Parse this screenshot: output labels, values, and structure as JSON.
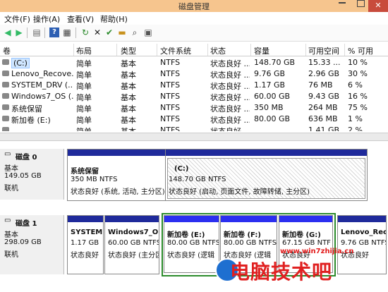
{
  "window": {
    "title": "磁盘管理"
  },
  "menu": [
    "文件(F)",
    "操作(A)",
    "查看(V)",
    "帮助(H)"
  ],
  "toolbar": [
    "back-icon",
    "forward-icon",
    "properties-icon",
    "help-icon",
    "view-icon",
    "refresh-icon",
    "delete-icon",
    "check-icon",
    "folder-open-icon",
    "search-icon",
    "settings-icon"
  ],
  "columns": [
    "卷",
    "布局",
    "类型",
    "文件系统",
    "状态",
    "容量",
    "可用空间",
    "% 可用"
  ],
  "volumes": [
    {
      "name": "(C:)",
      "layout": "简单",
      "type": "基本",
      "fs": "NTFS",
      "status": "状态良好 ...",
      "capacity": "148.70 GB",
      "free": "15.33 ...",
      "pct": "10 %"
    },
    {
      "name": "Lenovo_Recove...",
      "layout": "简单",
      "type": "基本",
      "fs": "NTFS",
      "status": "状态良好 ...",
      "capacity": "9.76 GB",
      "free": "2.96 GB",
      "pct": "30 %"
    },
    {
      "name": "SYSTEM_DRV (...",
      "layout": "简单",
      "type": "基本",
      "fs": "NTFS",
      "status": "状态良好 ...",
      "capacity": "1.17 GB",
      "free": "76 MB",
      "pct": "6 %"
    },
    {
      "name": "Windows7_OS (...",
      "layout": "简单",
      "type": "基本",
      "fs": "NTFS",
      "status": "状态良好 ...",
      "capacity": "60.00 GB",
      "free": "9.43 GB",
      "pct": "16 %"
    },
    {
      "name": "系统保留",
      "layout": "简单",
      "type": "基本",
      "fs": "NTFS",
      "status": "状态良好 ...",
      "capacity": "350 MB",
      "free": "264 MB",
      "pct": "75 %"
    },
    {
      "name": "新加卷 (E:)",
      "layout": "简单",
      "type": "基本",
      "fs": "NTFS",
      "status": "状态良好 ...",
      "capacity": "80.00 GB",
      "free": "636 MB",
      "pct": "1 %"
    },
    {
      "name": "...",
      "layout": "简单",
      "type": "基本",
      "fs": "NTFS",
      "status": "状态良好 ...",
      "capacity": "...",
      "free": "1.41 GB",
      "pct": "2 %"
    }
  ],
  "disk0": {
    "name": "磁盘 0",
    "type": "基本",
    "size": "149.05 GB",
    "state": "联机",
    "partitions": [
      {
        "name": "系统保留",
        "size": "350 MB NTFS",
        "status": "状态良好 (系统, 活动, 主分区)"
      },
      {
        "name": "(C:)",
        "size": "148.70 GB NTFS",
        "status": "状态良好 (启动, 页面文件, 故障转储, 主分区)"
      }
    ]
  },
  "disk1": {
    "name": "磁盘 1",
    "type": "基本",
    "size": "298.09 GB",
    "state": "联机",
    "partitions": [
      {
        "name": "SYSTEM",
        "size": "1.17 GB",
        "status": "状态良好"
      },
      {
        "name": "Windows7_OS",
        "size": "60.00 GB NTFS",
        "status": "状态良好 (主分区)"
      },
      {
        "name": "新加卷 (E:)",
        "size": "80.00 GB NTFS",
        "status": "状态良好 (逻辑"
      },
      {
        "name": "新加卷 (F:)",
        "size": "80.00 GB NTFS",
        "status": "状态良好 (逻辑"
      },
      {
        "name": "新加卷 (G:)",
        "size": "67.15 GB NTF",
        "status": "状态良好"
      },
      {
        "name": "Lenovo_Rec",
        "size": "9.76 GB NTFS",
        "status": "状态良好"
      }
    ]
  },
  "watermark": {
    "url": "www.win7zhijia.cn",
    "brand": "电脑技术吧"
  },
  "colors": {
    "partition_bar": "#1f2a9b",
    "selection_box": "#2b8b2b",
    "titlebar": "#f6c58e",
    "close": "#c84b3c"
  }
}
